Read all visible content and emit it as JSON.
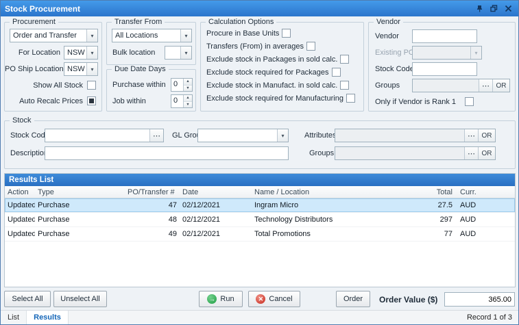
{
  "window": {
    "title": "Stock Procurement"
  },
  "icons": {
    "chevron_down": "▾",
    "ellipsis": "⋯",
    "spinner_up": "▲",
    "spinner_down": "▼",
    "run_arrow": "→",
    "cancel_x": "✕"
  },
  "procurement": {
    "caption": "Procurement",
    "mode": "Order and Transfer",
    "for_location": {
      "label": "For Location",
      "value": "NSW"
    },
    "po_ship_location": {
      "label": "PO Ship Location",
      "value": "NSW"
    },
    "show_all_stock": {
      "label": "Show All Stock",
      "checked": false
    },
    "auto_recalc": {
      "label": "Auto Recalc Prices",
      "checked": true
    }
  },
  "transfer_from": {
    "caption": "Transfer From",
    "location": "All Locations",
    "bulk_location_label": "Bulk location"
  },
  "due_date_days": {
    "caption": "Due Date Days",
    "purchase_within": {
      "label": "Purchase within",
      "value": "0"
    },
    "job_within": {
      "label": "Job within",
      "value": "0"
    }
  },
  "calculation_options": {
    "caption": "Calculation Options",
    "options": [
      {
        "label": "Procure in Base Units",
        "checked": false
      },
      {
        "label": "Transfers (From) in averages",
        "checked": false
      },
      {
        "label": "Exclude stock in Packages in sold calc.",
        "checked": false
      },
      {
        "label": "Exclude stock required for Packages",
        "checked": false
      },
      {
        "label": "Exclude stock in Manufact. in sold calc.",
        "checked": false
      },
      {
        "label": "Exclude stock required for Manufacturing",
        "checked": false
      }
    ]
  },
  "vendor": {
    "caption": "Vendor",
    "vendor_label": "Vendor",
    "existing_po_label": "Existing PO",
    "stock_code_label": "Stock Code",
    "groups_label": "Groups",
    "or_label": "OR",
    "rank": {
      "label": "Only if Vendor is Rank 1",
      "checked": false
    }
  },
  "stock": {
    "caption": "Stock",
    "stock_code_label": "Stock Code",
    "gl_group_label": "GL Group",
    "attributes_label": "Attributes",
    "description_label": "Description",
    "groups_label": "Groups",
    "or_label": "OR"
  },
  "results": {
    "caption": "Results List",
    "columns": [
      "Action",
      "Type",
      "PO/Transfer #",
      "Date",
      "Name / Location",
      "Total",
      "Curr."
    ],
    "rows": [
      {
        "action": "Updated",
        "type": "Purchase",
        "po_transfer": "47",
        "date": "02/12/2021",
        "name_location": "Ingram Micro",
        "total": "27.5",
        "curr": "AUD",
        "selected": true
      },
      {
        "action": "Updated",
        "type": "Purchase",
        "po_transfer": "48",
        "date": "02/12/2021",
        "name_location": "Technology Distributors",
        "total": "297",
        "curr": "AUD",
        "selected": false
      },
      {
        "action": "Updated",
        "type": "Purchase",
        "po_transfer": "49",
        "date": "02/12/2021",
        "name_location": "Total Promotions",
        "total": "77",
        "curr": "AUD",
        "selected": false
      }
    ]
  },
  "footer": {
    "select_all": "Select All",
    "unselect_all": "Unselect All",
    "run": "Run",
    "cancel": "Cancel",
    "order": "Order",
    "order_value_label": "Order Value ($)",
    "order_value": "365.00"
  },
  "status_bar": {
    "tabs": [
      "List",
      "Results"
    ],
    "record": "Record 1 of 3"
  }
}
